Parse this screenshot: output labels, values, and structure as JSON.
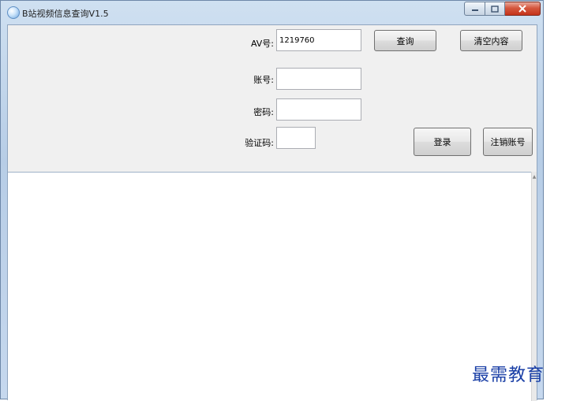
{
  "window": {
    "title": "B站视频信息查询V1.5",
    "icons": {
      "app": "app-icon",
      "minimize": "minimize-icon",
      "maximize": "maximize-icon",
      "close": "close-icon"
    }
  },
  "form": {
    "av_label": "AV号:",
    "av_value": "1219760",
    "account_label": "账号:",
    "account_value": "",
    "password_label": "密码:",
    "password_value": "",
    "captcha_label": "验证码:",
    "captcha_value": ""
  },
  "buttons": {
    "query": "查询",
    "clear": "清空内容",
    "login": "登录",
    "logout": "注销账号"
  },
  "output": {
    "text": ""
  },
  "watermark": "最需教育"
}
